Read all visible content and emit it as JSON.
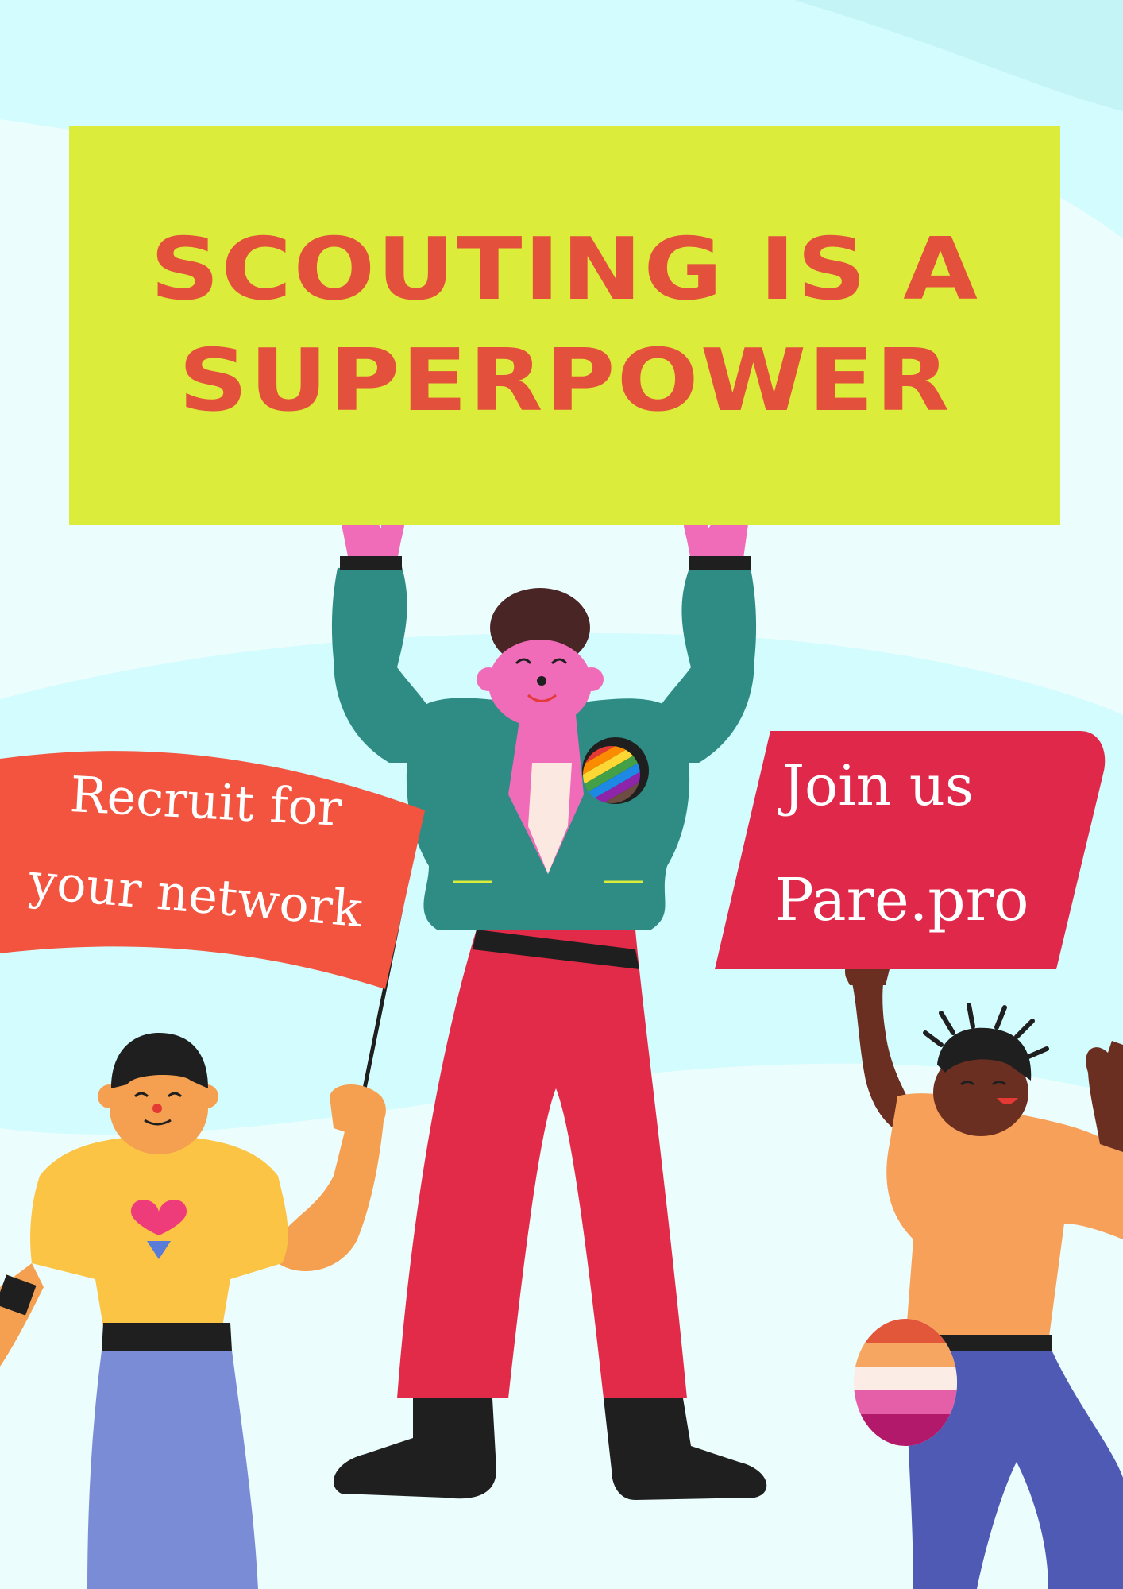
{
  "headline": {
    "line1": "SCOUTING IS A",
    "line2": "SUPERPOWER"
  },
  "flag_sign": {
    "line1": "Recruit for",
    "line2": "your network"
  },
  "join_sign": {
    "line1": "Join us",
    "line2": "Pare.pro"
  },
  "colors": {
    "background": "#ecfdfd",
    "headline_box": "#dcec3a",
    "headline_text": "#e3503b",
    "flag": "#f25440",
    "join_sign": "#e0294a",
    "jacket": "#2f8c85",
    "pants": "#e22b48"
  }
}
